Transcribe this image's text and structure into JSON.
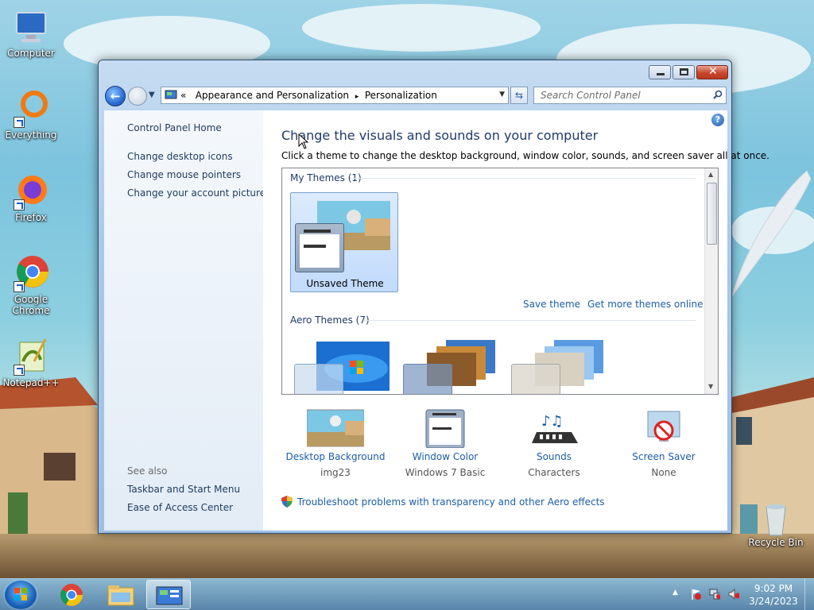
{
  "desktop": {
    "icons": [
      {
        "label": "Computer"
      },
      {
        "label": "Everything"
      },
      {
        "label": "Firefox"
      },
      {
        "label": "Google Chrome"
      },
      {
        "label": "Notepad++"
      },
      {
        "label": "Recycle Bin"
      }
    ]
  },
  "window": {
    "breadcrumb": {
      "prefix": "«",
      "items": [
        "Appearance and Personalization",
        "Personalization"
      ],
      "separator": "▸"
    },
    "search": {
      "placeholder": "Search Control Panel"
    },
    "left_pane": {
      "home": "Control Panel Home",
      "links": [
        "Change desktop icons",
        "Change mouse pointers",
        "Change your account picture"
      ],
      "see_also_label": "See also",
      "see_also": [
        "Taskbar and Start Menu",
        "Ease of Access Center"
      ]
    },
    "main": {
      "heading": "Change the visuals and sounds on your computer",
      "subtitle": "Click a theme to change the desktop background, window color, sounds, and screen saver all at once.",
      "my_themes_title": "My Themes (1)",
      "unsaved_theme": "Unsaved Theme",
      "save_theme": "Save theme",
      "get_more": "Get more themes online",
      "aero_themes_title": "Aero Themes (7)",
      "bottom": [
        {
          "label": "Desktop Background",
          "value": "img23"
        },
        {
          "label": "Window Color",
          "value": "Windows 7 Basic"
        },
        {
          "label": "Sounds",
          "value": "Characters"
        },
        {
          "label": "Screen Saver",
          "value": "None"
        }
      ],
      "troubleshoot": "Troubleshoot problems with transparency and other Aero effects"
    }
  },
  "taskbar": {
    "time": "9:02 PM",
    "date": "3/24/2023"
  },
  "colors": {
    "link": "#1a5ea8",
    "heading": "#1e3a6b",
    "close_button": "#c9462c"
  }
}
